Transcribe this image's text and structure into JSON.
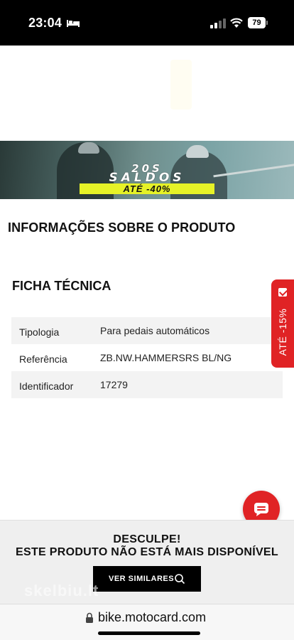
{
  "status_bar": {
    "time": "23:04",
    "battery": "79",
    "icons": [
      "bed-icon",
      "cellular-signal-icon",
      "wifi-icon",
      "battery-icon"
    ]
  },
  "banner": {
    "line1": "20S",
    "line2": "SALDOS",
    "discount": "ATÉ -40%",
    "colors": {
      "pill": "#e6f227"
    }
  },
  "product_info": {
    "title": "INFORMAÇÕES SOBRE O PRODUTO"
  },
  "spec_sheet": {
    "title": "FICHA TÉCNICA",
    "rows": [
      {
        "key": "Tipologia",
        "value": "Para pedais automáticos"
      },
      {
        "key": "Referência",
        "value": "ZB.NW.HAMMERSRS BL/NG"
      },
      {
        "key": "Identificador",
        "value": "17279"
      }
    ]
  },
  "promo_tab": {
    "label": "ATÉ -15%",
    "color": "#e02325"
  },
  "chat": {
    "icon": "chat-bubble-icon"
  },
  "unavailable": {
    "line1": "DESCULPE!",
    "line2": "ESTE PRODUTO NÃO ESTÁ MAIS DISPONÍVEL",
    "button_label": "VER SIMILARES",
    "watermark": "skelbiu.lt"
  },
  "browser": {
    "address": "bike.motocard.com"
  }
}
